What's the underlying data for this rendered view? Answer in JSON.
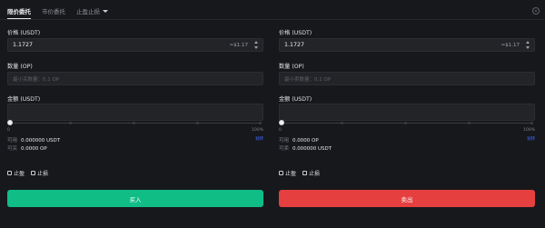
{
  "tabs": [
    {
      "label": "限价委托",
      "active": true
    },
    {
      "label": "市价委托",
      "active": false
    },
    {
      "label": "止盈止损",
      "active": false,
      "dropdown": true
    }
  ],
  "buy": {
    "price_label": "价格 (USDT)",
    "price_value": "1.1727",
    "price_approx": "≈$1.17",
    "qty_label": "数量 (OP)",
    "qty_placeholder": "最小买数量：0.1 OP",
    "amount_label": "金额 (USDT)",
    "slider_value": 0,
    "slider_min_label": "0",
    "slider_max_label": "100%",
    "available_label": "可用",
    "available_value": "0.000000 USDT",
    "transfer_label": "划转",
    "max_label": "可买",
    "max_value": "0.0000 OP",
    "cb1": "止盈",
    "cb2": "止损",
    "button": "买入",
    "color": "#0fbd85"
  },
  "sell": {
    "price_label": "价格 (USDT)",
    "price_value": "1.1727",
    "price_approx": "≈$1.17",
    "qty_label": "数量 (OP)",
    "qty_placeholder": "最小卖数量：0.1 OP",
    "amount_label": "金额 (USDT)",
    "slider_value": 0,
    "slider_min_label": "0",
    "slider_max_label": "100%",
    "available_label": "可用",
    "available_value": "0.0000 OP",
    "transfer_label": "划转",
    "max_label": "可卖",
    "max_value": "0.000000 USDT",
    "cb1": "止盈",
    "cb2": "止损",
    "button": "卖出",
    "color": "#e5403f"
  },
  "icons": {
    "settings": "settings-icon"
  }
}
